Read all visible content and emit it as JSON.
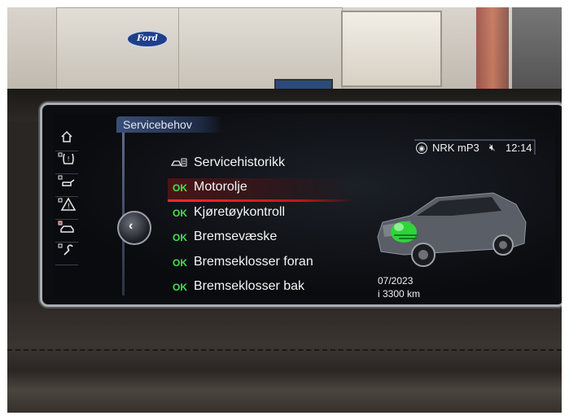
{
  "header": {
    "title": "Servicebehov"
  },
  "status_bar": {
    "radio_station": "NRK mP3",
    "clock": "12:14",
    "icons": [
      "radio-icon",
      "mute-icon"
    ]
  },
  "background": {
    "ford_logo_text": "Ford"
  },
  "side_menu": {
    "icons": [
      "home-icon",
      "tire-pressure-icon",
      "oil-icon",
      "warning-icon",
      "car-service-icon",
      "wrench-icon"
    ]
  },
  "service_items": [
    {
      "status": "",
      "label": "Servicehistorikk",
      "icon": "service-history-icon",
      "selected": false
    },
    {
      "status": "OK",
      "label": "Motorolje",
      "selected": true
    },
    {
      "status": "OK",
      "label": "Kjøretøykontroll",
      "selected": false
    },
    {
      "status": "OK",
      "label": "Bremsevæske",
      "selected": false
    },
    {
      "status": "OK",
      "label": "Bremseklosser foran",
      "selected": false
    },
    {
      "status": "OK",
      "label": "Bremseklosser bak",
      "selected": false
    }
  ],
  "detail": {
    "due_date": "07/2023",
    "due_distance": "i 3300 km"
  },
  "colors": {
    "ok_green": "#47e04e",
    "selection_red": "#d0161b",
    "title_bar_blue": "#3a4f78"
  }
}
